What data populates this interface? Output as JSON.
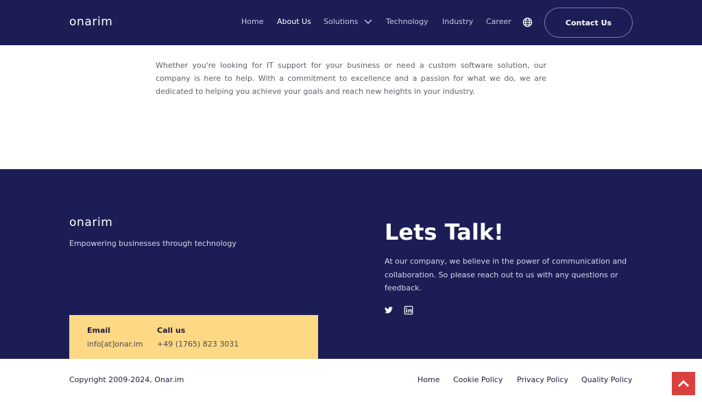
{
  "header": {
    "logo": "onarim",
    "nav": [
      "Home",
      "About Us",
      "Solutions",
      "Technology",
      "Industry",
      "Career"
    ],
    "active_nav": "About Us",
    "contact_button": "Contact Us",
    "icons": [
      "chevron-down-icon",
      "globe-icon"
    ]
  },
  "main": {
    "paragraph": "Whether you're looking for IT support for your business or need a custom software solution, our company is here to help. With a commitment to excellence and a passion for what we do, we are dedicated to helping you achieve your goals and reach new heights in your industry."
  },
  "footer": {
    "logo": "onarim",
    "tagline": "Empowering businesses through technology",
    "talk_title": "Lets Talk!",
    "talk_text": "At our company, we believe in the power of communication and collaboration. So please reach out to us with any questions or feedback.",
    "social_icons": [
      "twitter-icon",
      "linkedin-icon"
    ],
    "contact": {
      "email_label": "Email",
      "email_value": "info[at]onar.im",
      "phone_label": "Call us",
      "phone_value": "+49 (1765) 823 3031"
    }
  },
  "bottom_bar": {
    "copyright": "Copyright 2009-2024, Onar.im",
    "links": [
      "Home",
      "Cookie Policy",
      "Privacy Policy",
      "Quality Policy"
    ],
    "scroll_top_icon": "chevron-up-icon"
  },
  "colors": {
    "navy": "#1d1d56",
    "accent_yellow": "#fdd885",
    "scroll_top_red": "#d8413f"
  }
}
